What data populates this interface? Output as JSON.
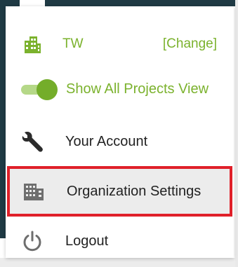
{
  "organization": {
    "name": "TW",
    "change_label": "[Change]",
    "icon": "building-icon"
  },
  "toggle": {
    "label": "Show All Projects View",
    "state": "on",
    "color_on": "#74ad2a"
  },
  "menu": {
    "items": [
      {
        "label": "Your Account",
        "icon": "wrench-icon"
      },
      {
        "label": "Organization Settings",
        "icon": "office-building-icon",
        "highlighted": true
      },
      {
        "label": "Logout",
        "icon": "power-icon"
      }
    ]
  },
  "colors": {
    "accent": "#7bb22d",
    "highlight_border": "#e0202a",
    "highlight_bg": "#ececec",
    "text": "#222222"
  }
}
